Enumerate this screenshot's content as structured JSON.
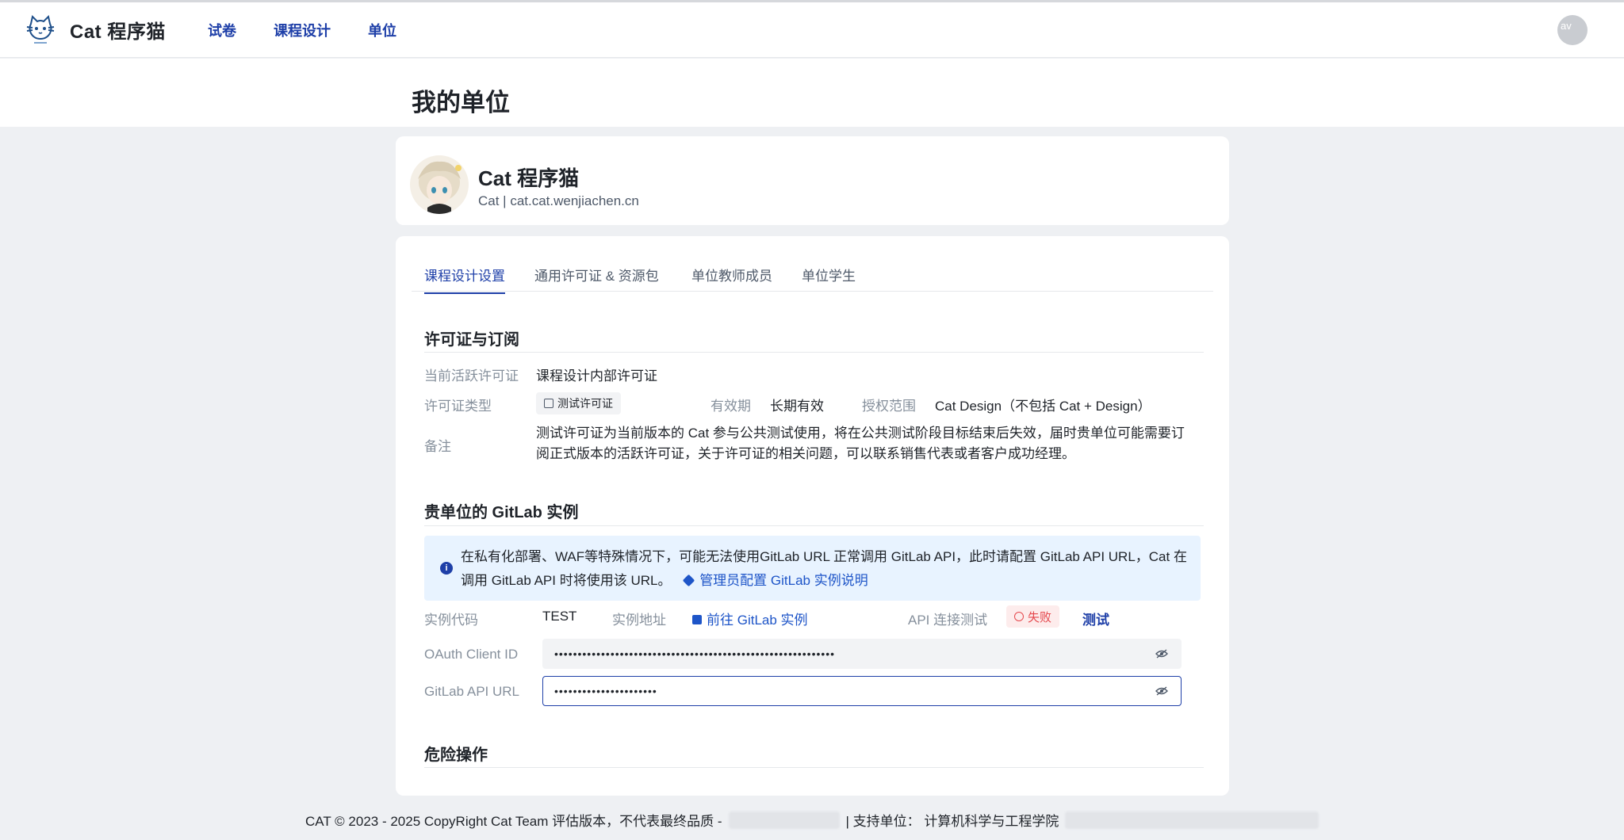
{
  "navbar": {
    "brand_name": "Cat 程序猫",
    "links": [
      "试卷",
      "课程设计",
      "单位"
    ],
    "user_avatar_alt": "av"
  },
  "page": {
    "title": "我的单位"
  },
  "org": {
    "name": "Cat 程序猫",
    "subtitle": "Cat | cat.cat.wenjiachen.cn"
  },
  "tabs": [
    "课程设计设置",
    "通用许可证 & 资源包",
    "单位教师成员",
    "单位学生"
  ],
  "license": {
    "section_title": "许可证与订阅",
    "current_label": "当前活跃许可证",
    "current_value": "课程设计内部许可证",
    "type_label": "许可证类型",
    "type_value": "测试许可证",
    "validity_label": "有效期",
    "validity_value": "长期有效",
    "scope_label": "授权范围",
    "scope_value": "Cat Design（不包括 Cat + Design）",
    "note_label": "备注",
    "note_value": " 测试许可证为当前版本的 Cat 参与公共测试使用，将在公共测试阶段目标结束后失效，届时贵单位可能需要订阅正式版本的活跃许可证，关于许可证的相关问题，可以联系销售代表或者客户成功经理。"
  },
  "gitlab": {
    "section_title": "贵单位的 GitLab 实例",
    "alert_text": "在私有化部署、WAF等特殊情况下，可能无法使用GitLab URL 正常调用 GitLab API，此时请配置 GitLab API URL，Cat 在调用 GitLab API 时将使用该 URL。",
    "alert_link": "管理员配置 GitLab 实例说明",
    "code_label": "实例代码",
    "code_value": "TEST",
    "address_label": "实例地址",
    "address_link": "前往 GitLab 实例",
    "api_test_label": "API 连接测试",
    "api_status": "失败",
    "test_button": "测试",
    "oauth_label": "OAuth Client ID",
    "oauth_value": "••••••••••••••••••••••••••••••••••••••••••••••••••••••••••••",
    "api_url_label": "GitLab API URL",
    "api_url_value": "••••••••••••••••••••••"
  },
  "danger": {
    "section_title": "危险操作"
  },
  "footer": {
    "copyright": "CAT © 2023 - 2025 CopyRight Cat Team 评估版本，不代表最终品质 -",
    "support": "| 支持单位： 计算机科学与工程学院"
  },
  "colors": {
    "accent": "#1e3fa8",
    "link": "#1e55c8",
    "alert_bg": "#e8f3ff",
    "fail": "#e5484d",
    "page_bg": "#eef0f3"
  }
}
